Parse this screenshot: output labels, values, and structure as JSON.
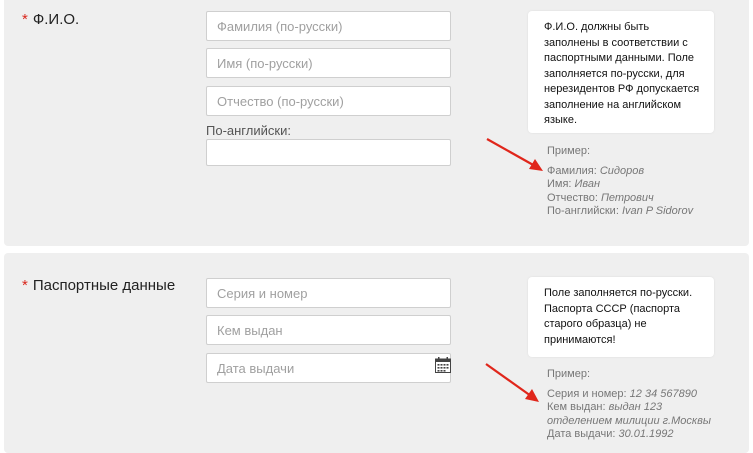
{
  "fio": {
    "label": "Ф.И.О.",
    "required_mark": "*",
    "fields": {
      "surname_placeholder": "Фамилия (по-русски)",
      "name_placeholder": "Имя (по-русски)",
      "patronymic_placeholder": "Отчество (по-русски)",
      "english_label": "По-английски:",
      "english_value": ""
    },
    "tip": "Ф.И.О. должны быть заполнены в соответствии с паспортными данными. Поле заполняется по-русски, для нерезидентов РФ допускается заполнение на английском языке.",
    "example": {
      "head": "Пример:",
      "rows": [
        {
          "key": "Фамилия:",
          "value": "Сидоров"
        },
        {
          "key": "Имя:",
          "value": "Иван"
        },
        {
          "key": "Отчество:",
          "value": "Петрович"
        },
        {
          "key": "По-английски:",
          "value": "Ivan P Sidorov"
        }
      ]
    }
  },
  "passport": {
    "label": "Паспортные данные",
    "required_mark": "*",
    "fields": {
      "series_placeholder": "Серия и номер",
      "issued_by_placeholder": "Кем выдан",
      "issue_date_placeholder": "Дата выдачи"
    },
    "calendar_icon": "calendar-icon",
    "tip": "Поле заполняется по-русски. Паспорта СССР (паспорта старого образца) не принимаются!",
    "example": {
      "head": "Пример:",
      "rows": [
        {
          "key": "Серия и номер:",
          "value": "12 34 567890"
        },
        {
          "key": "Кем выдан:",
          "value": "выдан 123 отделением милиции г.Москвы"
        },
        {
          "key": "Дата выдачи:",
          "value": "30.01.1992"
        }
      ]
    }
  },
  "colors": {
    "required": "#d9261c",
    "arrow": "#e0261b",
    "section_bg": "#efefef"
  }
}
